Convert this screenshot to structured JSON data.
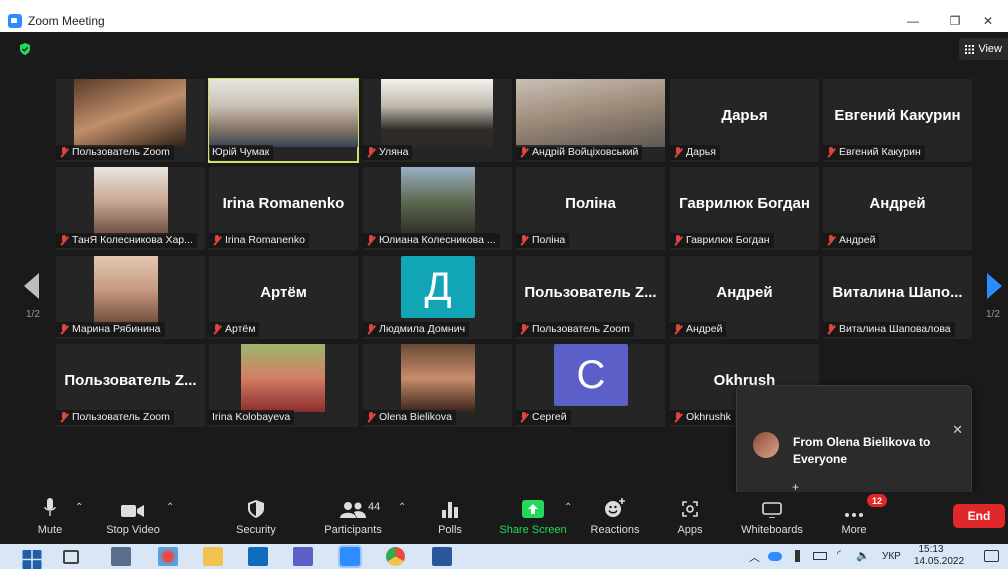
{
  "window": {
    "title": "Zoom Meeting",
    "minimize": "—",
    "restore": "❐",
    "close": "✕"
  },
  "view_button": {
    "label": "View",
    "icon": "grid-icon"
  },
  "pagination": {
    "left": "1/2",
    "right": "1/2"
  },
  "colors": {
    "active_speaker": "#c9e36b",
    "muted": "#e0443e",
    "share_green": "#23d959",
    "end_red": "#e02828",
    "zoom_blue": "#2d8cff"
  },
  "participants": [
    {
      "label": "Пользователь Zoom",
      "center_name": "",
      "muted": true,
      "video": "v1"
    },
    {
      "label": "Юрій Чумак",
      "center_name": "",
      "muted": false,
      "video": "v2",
      "active": true
    },
    {
      "label": "Уляна",
      "center_name": "",
      "muted": true,
      "video": "v3"
    },
    {
      "label": "Андрій Войціховський",
      "center_name": "",
      "muted": true,
      "video": "v4"
    },
    {
      "label": "Дарья",
      "center_name": "Дарья",
      "muted": true
    },
    {
      "label": "Евгений Какурин",
      "center_name": "Евгений Какурин",
      "muted": true
    },
    {
      "label": "ТанЯ Колесникова Хар...",
      "center_name": "",
      "muted": true,
      "video": "v5"
    },
    {
      "label": "Irina Romanenko",
      "center_name": "Irina Romanenko",
      "muted": true
    },
    {
      "label": "Юлиана Колесникова ...",
      "center_name": "",
      "muted": true,
      "video": "v6"
    },
    {
      "label": "Поліна",
      "center_name": "Поліна",
      "muted": true
    },
    {
      "label": "Гаврилюк Богдан",
      "center_name": "Гаврилюк Богдан",
      "muted": true
    },
    {
      "label": "Андрей",
      "center_name": "Андрей",
      "muted": true
    },
    {
      "label": "Марина Рябинина",
      "center_name": "",
      "muted": true,
      "video": "v7"
    },
    {
      "label": "Артём",
      "center_name": "Артём",
      "muted": true
    },
    {
      "label": "Людмила Домнич",
      "center_name": "",
      "muted": true,
      "avatar": "Д"
    },
    {
      "label": "Пользователь Zoom",
      "center_name": "Пользователь Z...",
      "muted": true
    },
    {
      "label": "Андрей",
      "center_name": "Андрей",
      "muted": true
    },
    {
      "label": "Виталина Шаповалова",
      "center_name": "Виталина Шапо...",
      "muted": true
    },
    {
      "label": "Пользователь Zoom",
      "center_name": "Пользователь Z...",
      "muted": true
    },
    {
      "label": "Irina Kolobayeva",
      "center_name": "",
      "muted": false,
      "video": "v8"
    },
    {
      "label": "Olena Bielikova",
      "center_name": "",
      "muted": true,
      "video": "v9"
    },
    {
      "label": "Сергей",
      "center_name": "",
      "muted": true,
      "avatar": "С"
    },
    {
      "label": "Okhrushk",
      "center_name": "Okhrush",
      "muted": true
    }
  ],
  "chat_popup": {
    "from": "From Olena Bielikova to Everyone",
    "plus": "+",
    "close": "✕"
  },
  "toolbar": {
    "mute": "Mute",
    "stop_video": "Stop Video",
    "security": "Security",
    "participants": "Participants",
    "participants_count": "44",
    "polls": "Polls",
    "share_screen": "Share Screen",
    "reactions": "Reactions",
    "apps": "Apps",
    "whiteboards": "Whiteboards",
    "more": "More",
    "more_badge": "12",
    "end": "End"
  },
  "taskbar": {
    "lang": "УКР",
    "time": "15:13",
    "date": "14.05.2022"
  }
}
